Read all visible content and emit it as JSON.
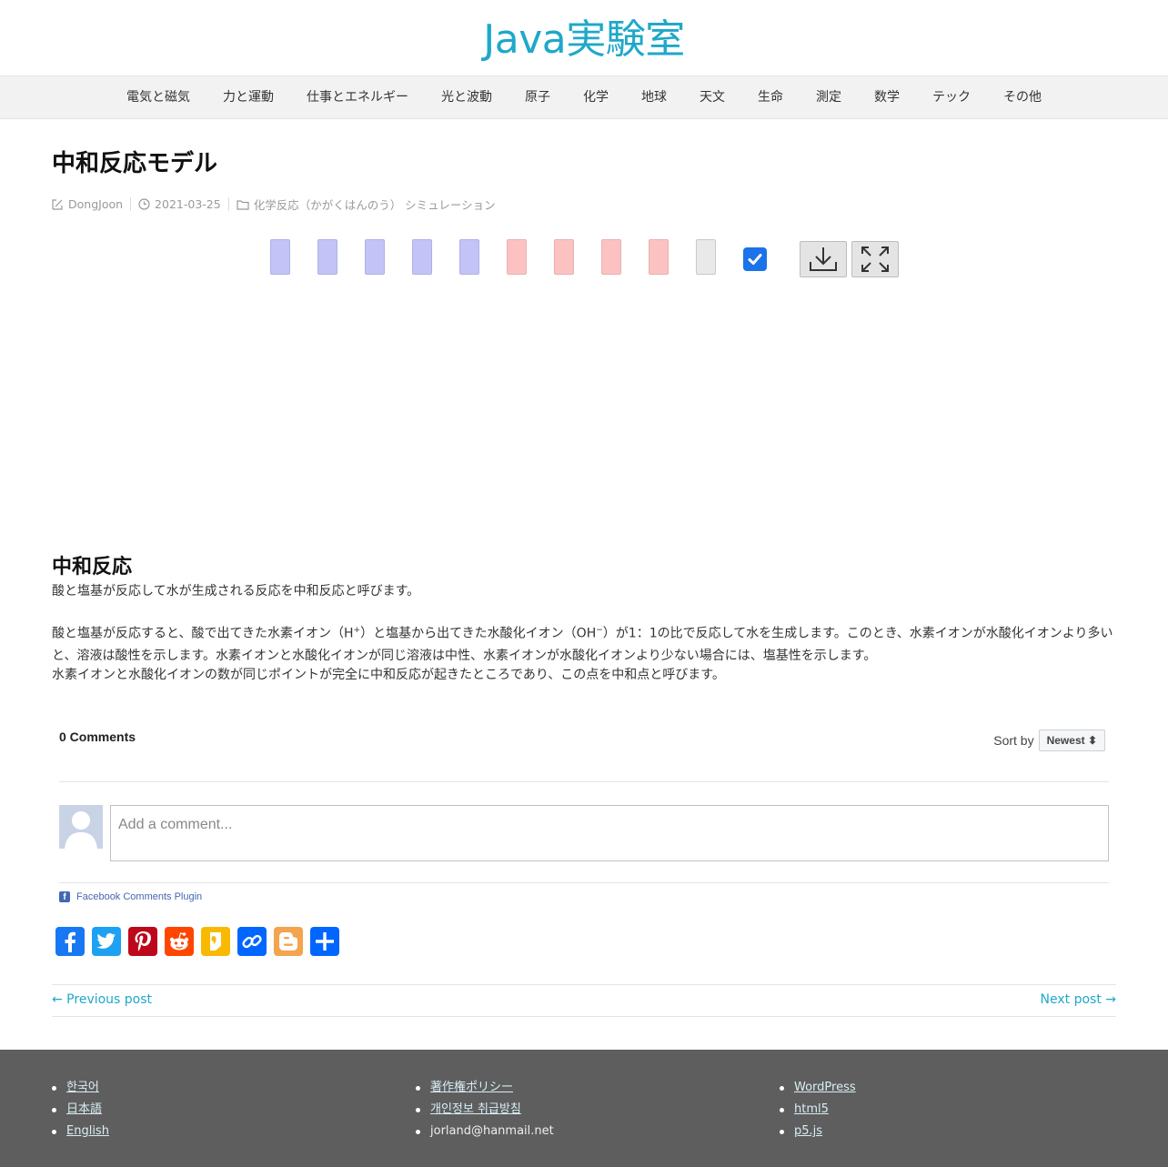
{
  "site": {
    "title": "Java実験室"
  },
  "nav": [
    "電気と磁気",
    "力と運動",
    "仕事とエネルギー",
    "光と波動",
    "原子",
    "化学",
    "地球",
    "天文",
    "生命",
    "測定",
    "数学",
    "テック",
    "その他"
  ],
  "post": {
    "title": "中和反応モデル",
    "author": "DongJoon",
    "date": "2021-03-25",
    "categories": "化学反応（かがくはんのう）  シミュレーション"
  },
  "simulation": {
    "checkbox_checked": true,
    "colors": {
      "acid": "#c3c3f8",
      "base": "#fcc2c2",
      "neutral": "#e9e9e9",
      "checkbox": "#1a73e8"
    },
    "tools": [
      "download-icon",
      "fullscreen-icon"
    ]
  },
  "article": {
    "heading": "中和反応",
    "intro": "酸と塩基が反応して水が生成される反応を中和反応と呼びます。",
    "p1_before_h": "酸と塩基が反応すると、酸で出てきた水素イオン（H",
    "p1_h_sup": "+",
    "p1_mid": "）と塩基から出てきた水酸化イオン（OH",
    "p1_oh_sup": "−",
    "p1_after": "）が1：1の比で反応して水を生成します。このとき、水素イオンが水酸化イオンより多いと、溶液は酸性を示します。水素イオンと水酸化イオンが同じ溶液は中性、水素イオンが水酸化イオンより少ない場合には、塩基性を示します。",
    "p2": "水素イオンと水酸化イオンの数が同じポイントが完全に中和反応が起きたところであり、この点を中和点と呼びます。"
  },
  "comments": {
    "count_label": "0 Comments",
    "sort_label": "Sort by",
    "sort_value": "Newest ⬍",
    "placeholder": "Add a comment...",
    "plugin_label": "Facebook Comments Plugin"
  },
  "share": [
    "facebook-icon",
    "twitter-icon",
    "pinterest-icon",
    "reddit-icon",
    "kakao-icon",
    "copy-link-icon",
    "blogger-icon",
    "share-icon"
  ],
  "post_nav": {
    "prev": "← Previous post",
    "next": "Next post →"
  },
  "footer": {
    "col1": [
      "한국어",
      "日本語",
      "English"
    ],
    "col2": [
      "著作権ポリシー",
      "개인정보 취급방침",
      "jorland@hanmail.net"
    ],
    "col3": [
      "WordPress",
      "html5",
      "p5.js"
    ]
  }
}
